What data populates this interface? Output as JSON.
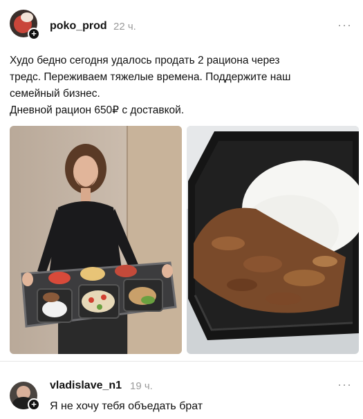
{
  "post": {
    "username": "poko_prod",
    "time": "22 ч.",
    "more": "···",
    "lines": [
      "Худо бедно сегодня удалось продать 2 рациона через",
      "тредс. Переживаем тяжелые времена. Поддержите наш",
      "семейный бизнес.",
      "Дневной рацион 650₽ с доставкой."
    ],
    "images": [
      {
        "icon": "photo-man-with-food-tray"
      },
      {
        "icon": "photo-rice-with-beef-container"
      }
    ]
  },
  "comment": {
    "username": "vladislave_n1",
    "time": "19 ч.",
    "more": "···",
    "text": "Я не хочу тебя объедать брат"
  },
  "colors": {
    "accent_red": "#d93a2b",
    "muted": "#9a9a9a"
  }
}
